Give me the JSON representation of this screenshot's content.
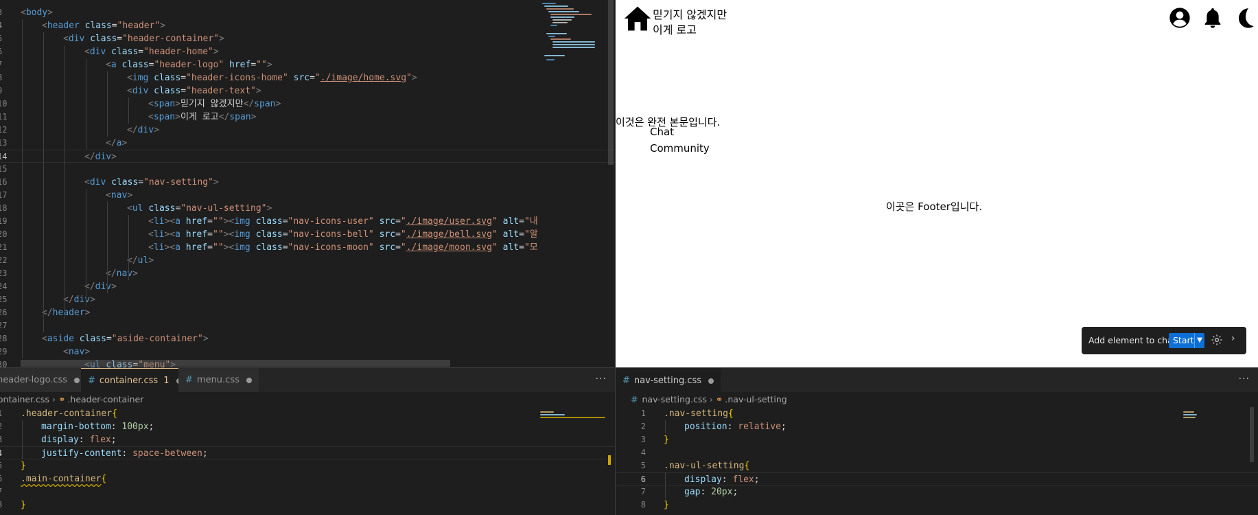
{
  "html_editor": {
    "lines": [
      {
        "n": "3",
        "tokens": [
          [
            "t-br",
            "<"
          ],
          [
            "t-tag",
            "body"
          ],
          [
            "t-br",
            ">"
          ]
        ]
      },
      {
        "n": "4",
        "tokens": [
          [
            "t-br",
            "<"
          ],
          [
            "t-tag",
            "header "
          ],
          [
            "t-attr",
            "class"
          ],
          [
            "t-punc",
            "="
          ],
          [
            "t-str",
            "\"header\""
          ],
          [
            "t-br",
            ">"
          ]
        ]
      },
      {
        "n": "5",
        "tokens": [
          [
            "t-br",
            "<"
          ],
          [
            "t-tag",
            "div "
          ],
          [
            "t-attr",
            "class"
          ],
          [
            "t-punc",
            "="
          ],
          [
            "t-str",
            "\"header-container\""
          ],
          [
            "t-br",
            ">"
          ]
        ]
      },
      {
        "n": "6",
        "tokens": [
          [
            "t-br",
            "<"
          ],
          [
            "t-tag",
            "div "
          ],
          [
            "t-attr",
            "class"
          ],
          [
            "t-punc",
            "="
          ],
          [
            "t-str",
            "\"header-home\""
          ],
          [
            "t-br",
            ">"
          ]
        ]
      },
      {
        "n": "7",
        "tokens": [
          [
            "t-br",
            "<"
          ],
          [
            "t-tag",
            "a "
          ],
          [
            "t-attr",
            "class"
          ],
          [
            "t-punc",
            "="
          ],
          [
            "t-str",
            "\"header-logo\" "
          ],
          [
            "t-attr",
            "href"
          ],
          [
            "t-punc",
            "="
          ],
          [
            "t-str",
            "\"\""
          ],
          [
            "t-br",
            ">"
          ]
        ]
      },
      {
        "n": "8",
        "tokens": [
          [
            "t-br",
            "<"
          ],
          [
            "t-tag",
            "img "
          ],
          [
            "t-attr",
            "class"
          ],
          [
            "t-punc",
            "="
          ],
          [
            "t-str",
            "\"header-icons-home\" "
          ],
          [
            "t-attr",
            "src"
          ],
          [
            "t-punc",
            "="
          ],
          [
            "t-str",
            "\""
          ],
          [
            "t-link",
            "./image/home.svg"
          ],
          [
            "t-str",
            "\""
          ],
          [
            "t-br",
            ">"
          ]
        ]
      },
      {
        "n": "9",
        "tokens": [
          [
            "t-br",
            "<"
          ],
          [
            "t-tag",
            "div "
          ],
          [
            "t-attr",
            "class"
          ],
          [
            "t-punc",
            "="
          ],
          [
            "t-str",
            "\"header-text\""
          ],
          [
            "t-br",
            ">"
          ]
        ]
      },
      {
        "n": "10",
        "tokens": [
          [
            "t-br",
            "<"
          ],
          [
            "t-tag",
            "span"
          ],
          [
            "t-br",
            ">"
          ],
          [
            "t-text",
            "믿기지 않겠지만"
          ],
          [
            "t-br",
            "</"
          ],
          [
            "t-tag",
            "span"
          ],
          [
            "t-br",
            ">"
          ]
        ]
      },
      {
        "n": "11",
        "tokens": [
          [
            "t-br",
            "<"
          ],
          [
            "t-tag",
            "span"
          ],
          [
            "t-br",
            ">"
          ],
          [
            "t-text",
            "이게 로고"
          ],
          [
            "t-br",
            "</"
          ],
          [
            "t-tag",
            "span"
          ],
          [
            "t-br",
            ">"
          ]
        ]
      },
      {
        "n": "12",
        "tokens": [
          [
            "t-br",
            "</"
          ],
          [
            "t-tag",
            "div"
          ],
          [
            "t-br",
            ">"
          ]
        ]
      },
      {
        "n": "13",
        "tokens": [
          [
            "t-br",
            "</"
          ],
          [
            "t-tag",
            "a"
          ],
          [
            "t-br",
            ">"
          ]
        ]
      },
      {
        "n": "14",
        "tokens": [
          [
            "t-br",
            "</"
          ],
          [
            "t-tag",
            "div"
          ],
          [
            "t-br",
            ">"
          ]
        ]
      },
      {
        "n": "15",
        "tokens": []
      },
      {
        "n": "16",
        "tokens": [
          [
            "t-br",
            "<"
          ],
          [
            "t-tag",
            "div "
          ],
          [
            "t-attr",
            "class"
          ],
          [
            "t-punc",
            "="
          ],
          [
            "t-str",
            "\"nav-setting\""
          ],
          [
            "t-br",
            ">"
          ]
        ]
      },
      {
        "n": "17",
        "tokens": [
          [
            "t-br",
            "<"
          ],
          [
            "t-tag",
            "nav"
          ],
          [
            "t-br",
            ">"
          ]
        ]
      },
      {
        "n": "18",
        "tokens": [
          [
            "t-br",
            "<"
          ],
          [
            "t-tag",
            "ul "
          ],
          [
            "t-attr",
            "class"
          ],
          [
            "t-punc",
            "="
          ],
          [
            "t-str",
            "\"nav-ul-setting\""
          ],
          [
            "t-br",
            ">"
          ]
        ]
      },
      {
        "n": "19",
        "tokens": [
          [
            "t-br",
            "<"
          ],
          [
            "t-tag",
            "li"
          ],
          [
            "t-br",
            "><"
          ],
          [
            "t-tag",
            "a "
          ],
          [
            "t-attr",
            "href"
          ],
          [
            "t-punc",
            "="
          ],
          [
            "t-str",
            "\"\""
          ],
          [
            "t-br",
            "><"
          ],
          [
            "t-tag",
            "img "
          ],
          [
            "t-attr",
            "class"
          ],
          [
            "t-punc",
            "="
          ],
          [
            "t-str",
            "\"nav-icons-user\" "
          ],
          [
            "t-attr",
            "src"
          ],
          [
            "t-punc",
            "="
          ],
          [
            "t-str",
            "\""
          ],
          [
            "t-link",
            "./image/user.svg"
          ],
          [
            "t-str",
            "\" "
          ],
          [
            "t-attr",
            "alt"
          ],
          [
            "t-punc",
            "="
          ],
          [
            "t-str",
            "\"내"
          ]
        ]
      },
      {
        "n": "20",
        "tokens": [
          [
            "t-br",
            "<"
          ],
          [
            "t-tag",
            "li"
          ],
          [
            "t-br",
            "><"
          ],
          [
            "t-tag",
            "a "
          ],
          [
            "t-attr",
            "href"
          ],
          [
            "t-punc",
            "="
          ],
          [
            "t-str",
            "\"\""
          ],
          [
            "t-br",
            "><"
          ],
          [
            "t-tag",
            "img "
          ],
          [
            "t-attr",
            "class"
          ],
          [
            "t-punc",
            "="
          ],
          [
            "t-str",
            "\"nav-icons-bell\" "
          ],
          [
            "t-attr",
            "src"
          ],
          [
            "t-punc",
            "="
          ],
          [
            "t-str",
            "\""
          ],
          [
            "t-link",
            "./image/bell.svg"
          ],
          [
            "t-str",
            "\" "
          ],
          [
            "t-attr",
            "alt"
          ],
          [
            "t-punc",
            "="
          ],
          [
            "t-str",
            "\"알"
          ]
        ]
      },
      {
        "n": "21",
        "tokens": [
          [
            "t-br",
            "<"
          ],
          [
            "t-tag",
            "li"
          ],
          [
            "t-br",
            "><"
          ],
          [
            "t-tag",
            "a "
          ],
          [
            "t-attr",
            "href"
          ],
          [
            "t-punc",
            "="
          ],
          [
            "t-str",
            "\"\""
          ],
          [
            "t-br",
            "><"
          ],
          [
            "t-tag",
            "img "
          ],
          [
            "t-attr",
            "class"
          ],
          [
            "t-punc",
            "="
          ],
          [
            "t-str",
            "\"nav-icons-moon\" "
          ],
          [
            "t-attr",
            "src"
          ],
          [
            "t-punc",
            "="
          ],
          [
            "t-str",
            "\""
          ],
          [
            "t-link",
            "./image/moon.svg"
          ],
          [
            "t-str",
            "\" "
          ],
          [
            "t-attr",
            "alt"
          ],
          [
            "t-punc",
            "="
          ],
          [
            "t-str",
            "\"모"
          ]
        ]
      },
      {
        "n": "22",
        "tokens": [
          [
            "t-br",
            "</"
          ],
          [
            "t-tag",
            "ul"
          ],
          [
            "t-br",
            ">"
          ]
        ]
      },
      {
        "n": "23",
        "tokens": [
          [
            "t-br",
            "</"
          ],
          [
            "t-tag",
            "nav"
          ],
          [
            "t-br",
            ">"
          ]
        ]
      },
      {
        "n": "24",
        "tokens": [
          [
            "t-br",
            "</"
          ],
          [
            "t-tag",
            "div"
          ],
          [
            "t-br",
            ">"
          ]
        ]
      },
      {
        "n": "25",
        "tokens": [
          [
            "t-br",
            "</"
          ],
          [
            "t-tag",
            "div"
          ],
          [
            "t-br",
            ">"
          ]
        ]
      },
      {
        "n": "26",
        "tokens": [
          [
            "t-br",
            "</"
          ],
          [
            "t-tag",
            "header"
          ],
          [
            "t-br",
            ">"
          ]
        ]
      },
      {
        "n": "27",
        "tokens": []
      },
      {
        "n": "28",
        "tokens": [
          [
            "t-br",
            "<"
          ],
          [
            "t-tag",
            "aside "
          ],
          [
            "t-attr",
            "class"
          ],
          [
            "t-punc",
            "="
          ],
          [
            "t-str",
            "\"aside-container\""
          ],
          [
            "t-br",
            ">"
          ]
        ]
      },
      {
        "n": "29",
        "tokens": [
          [
            "t-br",
            "<"
          ],
          [
            "t-tag",
            "nav"
          ],
          [
            "t-br",
            ">"
          ]
        ]
      },
      {
        "n": "30",
        "tokens": [
          [
            "t-br",
            "<"
          ],
          [
            "t-tag",
            "ul "
          ],
          [
            "t-attr",
            "class"
          ],
          [
            "t-punc",
            "="
          ],
          [
            "t-str",
            "\"menu\""
          ],
          [
            "t-br",
            ">"
          ]
        ]
      }
    ]
  },
  "preview": {
    "logo_line1": "믿기지 않겠지만",
    "logo_line2": "이게 로고",
    "main_text": "이것은 완전 본문입니다.",
    "menu_items": [
      "Chat",
      "Community"
    ],
    "footer_text": "이곳은 Footer입니다.",
    "chat_widget": {
      "label": "Add element to chat",
      "start": "Start"
    }
  },
  "left_bottom": {
    "tabs": [
      {
        "label": "header-logo.css",
        "active": false,
        "badge": ""
      },
      {
        "label": "container.css",
        "active": true,
        "badge": "1"
      },
      {
        "label": "menu.css",
        "active": false,
        "badge": ""
      }
    ],
    "breadcrumb": {
      "file": "container.css",
      "symbol": ".header-container"
    },
    "lines": [
      {
        "n": "1",
        "tokens": [
          [
            "t-sel",
            ".header-container"
          ],
          [
            "t-brace",
            "{"
          ]
        ]
      },
      {
        "n": "2",
        "tokens": [
          [
            "t-prop",
            "margin-bottom"
          ],
          [
            "t-punc",
            ": "
          ],
          [
            "t-num",
            "100px"
          ],
          [
            "t-punc",
            ";"
          ]
        ]
      },
      {
        "n": "3",
        "tokens": [
          [
            "t-prop",
            "display"
          ],
          [
            "t-punc",
            ": "
          ],
          [
            "t-val",
            "flex"
          ],
          [
            "t-punc",
            ";"
          ]
        ]
      },
      {
        "n": "4",
        "tokens": [
          [
            "t-prop",
            "justify-content"
          ],
          [
            "t-punc",
            ": "
          ],
          [
            "t-val",
            "space-between"
          ],
          [
            "t-punc",
            ";"
          ]
        ]
      },
      {
        "n": "5",
        "tokens": [
          [
            "t-brace",
            "}"
          ]
        ]
      },
      {
        "n": "6",
        "tokens": [
          [
            "t-sel squiggle",
            ".main-container"
          ],
          [
            "t-brace",
            "{"
          ]
        ]
      },
      {
        "n": "7",
        "tokens": []
      },
      {
        "n": "8",
        "tokens": [
          [
            "t-brace",
            "}"
          ]
        ]
      }
    ]
  },
  "right_bottom": {
    "tabs": [
      {
        "label": "nav-setting.css",
        "active": true,
        "badge": ""
      }
    ],
    "breadcrumb": {
      "file": "nav-setting.css",
      "symbol": ".nav-ul-setting"
    },
    "lines": [
      {
        "n": "1",
        "tokens": [
          [
            "t-sel",
            ".nav-setting"
          ],
          [
            "t-brace",
            "{"
          ]
        ]
      },
      {
        "n": "2",
        "tokens": [
          [
            "t-prop",
            "position"
          ],
          [
            "t-punc",
            ": "
          ],
          [
            "t-val",
            "relative"
          ],
          [
            "t-punc",
            ";"
          ]
        ]
      },
      {
        "n": "3",
        "tokens": [
          [
            "t-brace",
            "}"
          ]
        ]
      },
      {
        "n": "4",
        "tokens": []
      },
      {
        "n": "5",
        "tokens": [
          [
            "t-sel",
            ".nav-ul-setting"
          ],
          [
            "t-brace",
            "{"
          ]
        ]
      },
      {
        "n": "6",
        "tokens": [
          [
            "t-prop",
            "display"
          ],
          [
            "t-punc",
            ": "
          ],
          [
            "t-val",
            "flex"
          ],
          [
            "t-punc",
            ";"
          ]
        ]
      },
      {
        "n": "7",
        "tokens": [
          [
            "t-prop",
            "gap"
          ],
          [
            "t-punc",
            ": "
          ],
          [
            "t-num",
            "20px"
          ],
          [
            "t-punc",
            ";"
          ]
        ]
      },
      {
        "n": "8",
        "tokens": [
          [
            "t-brace",
            "}"
          ]
        ]
      }
    ]
  },
  "colors": {
    "editor_bg": "#1e1e1e",
    "accent_tab": "#e2c08d",
    "start_button": "#0e6fd6"
  }
}
